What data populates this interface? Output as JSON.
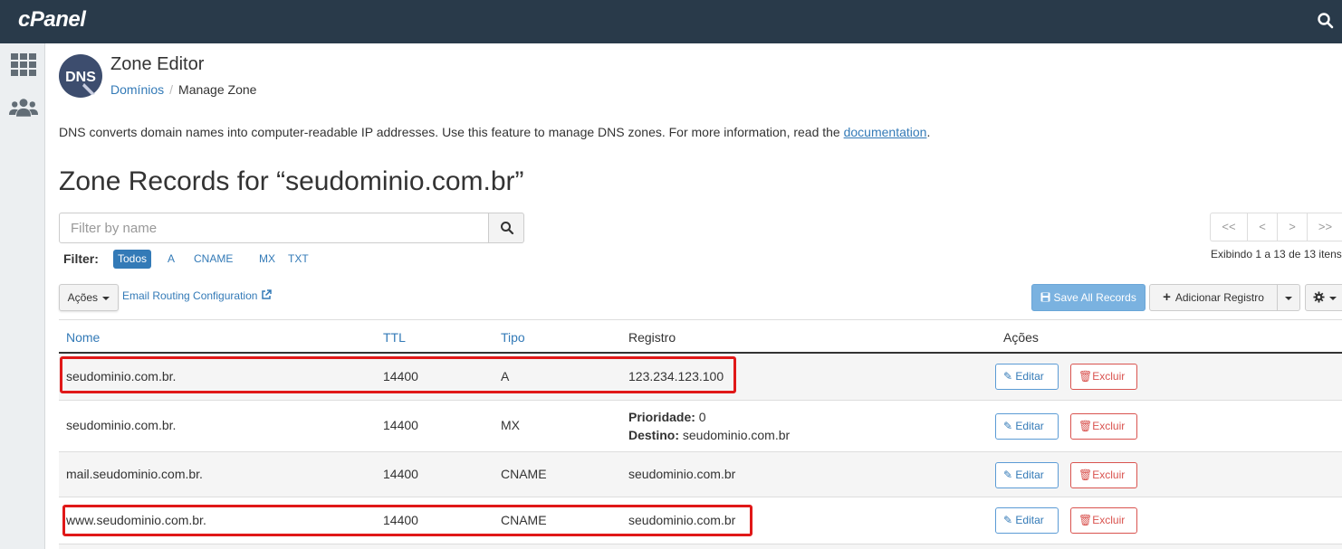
{
  "header": {
    "logo": "cPanel"
  },
  "sidebar": {
    "icons": [
      "apps-grid-icon",
      "users-icon"
    ]
  },
  "app": {
    "icon_text": "DNS",
    "title": "Zone Editor",
    "breadcrumb": {
      "parent": "Domínios",
      "separator": "/",
      "current": "Manage Zone"
    }
  },
  "description": {
    "text": "DNS converts domain names into computer-readable IP addresses. Use this feature to manage DNS zones. For more information, read the ",
    "link": "documentation",
    "suffix": "."
  },
  "zone_title": "Zone Records for “seudominio.com.br”",
  "search": {
    "placeholder": "Filter by name"
  },
  "filter": {
    "label": "Filter:",
    "options": [
      "Todos",
      "A",
      "CNAME",
      "MX",
      "TXT"
    ],
    "selected": "Todos"
  },
  "pager": {
    "buttons": [
      "<<",
      "<",
      ">",
      ">>"
    ],
    "info": "Exibindo 1 a 13 de 13 itens"
  },
  "toolbar": {
    "actions_label": "Ações",
    "email_routing": "Email Routing Configuration",
    "save_all": "Save All Records",
    "add_record": "Adicionar Registro"
  },
  "table": {
    "headers": {
      "name": "Nome",
      "ttl": "TTL",
      "type": "Tipo",
      "record": "Registro",
      "actions": "Ações"
    },
    "edit_label": "Editar",
    "delete_label": "Excluir",
    "rows": [
      {
        "name": "seudominio.com.br.",
        "ttl": "14400",
        "type": "A",
        "record": "123.234.123.100",
        "highlighted": true
      },
      {
        "name": "seudominio.com.br.",
        "ttl": "14400",
        "type": "MX",
        "priority_label": "Prioridade:",
        "priority_value": "0",
        "dest_label": "Destino:",
        "dest_value": "seudominio.com.br",
        "highlighted": false
      },
      {
        "name": "mail.seudominio.com.br.",
        "ttl": "14400",
        "type": "CNAME",
        "record": "seudominio.com.br",
        "highlighted": false
      },
      {
        "name": "www.seudominio.com.br.",
        "ttl": "14400",
        "type": "CNAME",
        "record": "seudominio.com.br",
        "highlighted": true
      }
    ]
  },
  "colors": {
    "topbar": "#293a4a",
    "link": "#337ab7",
    "delete": "#d9534f",
    "highlight": "#e01818",
    "save_button": "#7ab2e0"
  }
}
